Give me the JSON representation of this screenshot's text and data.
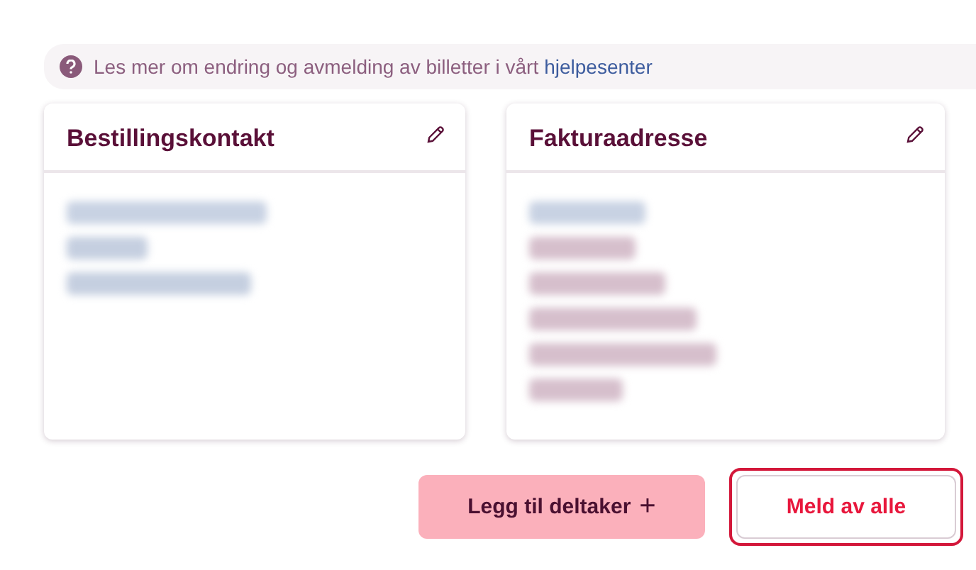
{
  "info_banner": {
    "text": "Les mer om endring og avmelding av billetter i vårt",
    "link": "hjelpesenter"
  },
  "cards": [
    {
      "title": "Bestillingskontakt",
      "lines": [
        {
          "kind": "redacted"
        },
        {
          "kind": "redacted"
        },
        {
          "kind": "redacted"
        }
      ]
    },
    {
      "title": "Fakturaadresse",
      "lines": [
        {
          "kind": "redacted"
        },
        {
          "kind": "redacted"
        },
        {
          "kind": "redacted"
        },
        {
          "kind": "redacted"
        },
        {
          "kind": "redacted"
        },
        {
          "kind": "redacted"
        }
      ]
    }
  ],
  "buttons": [
    {
      "label": "Legg til deltaker",
      "icon": "+",
      "kind": "primary"
    },
    {
      "label": "Meld av alle",
      "kind": "outline",
      "focused": true
    }
  ]
}
